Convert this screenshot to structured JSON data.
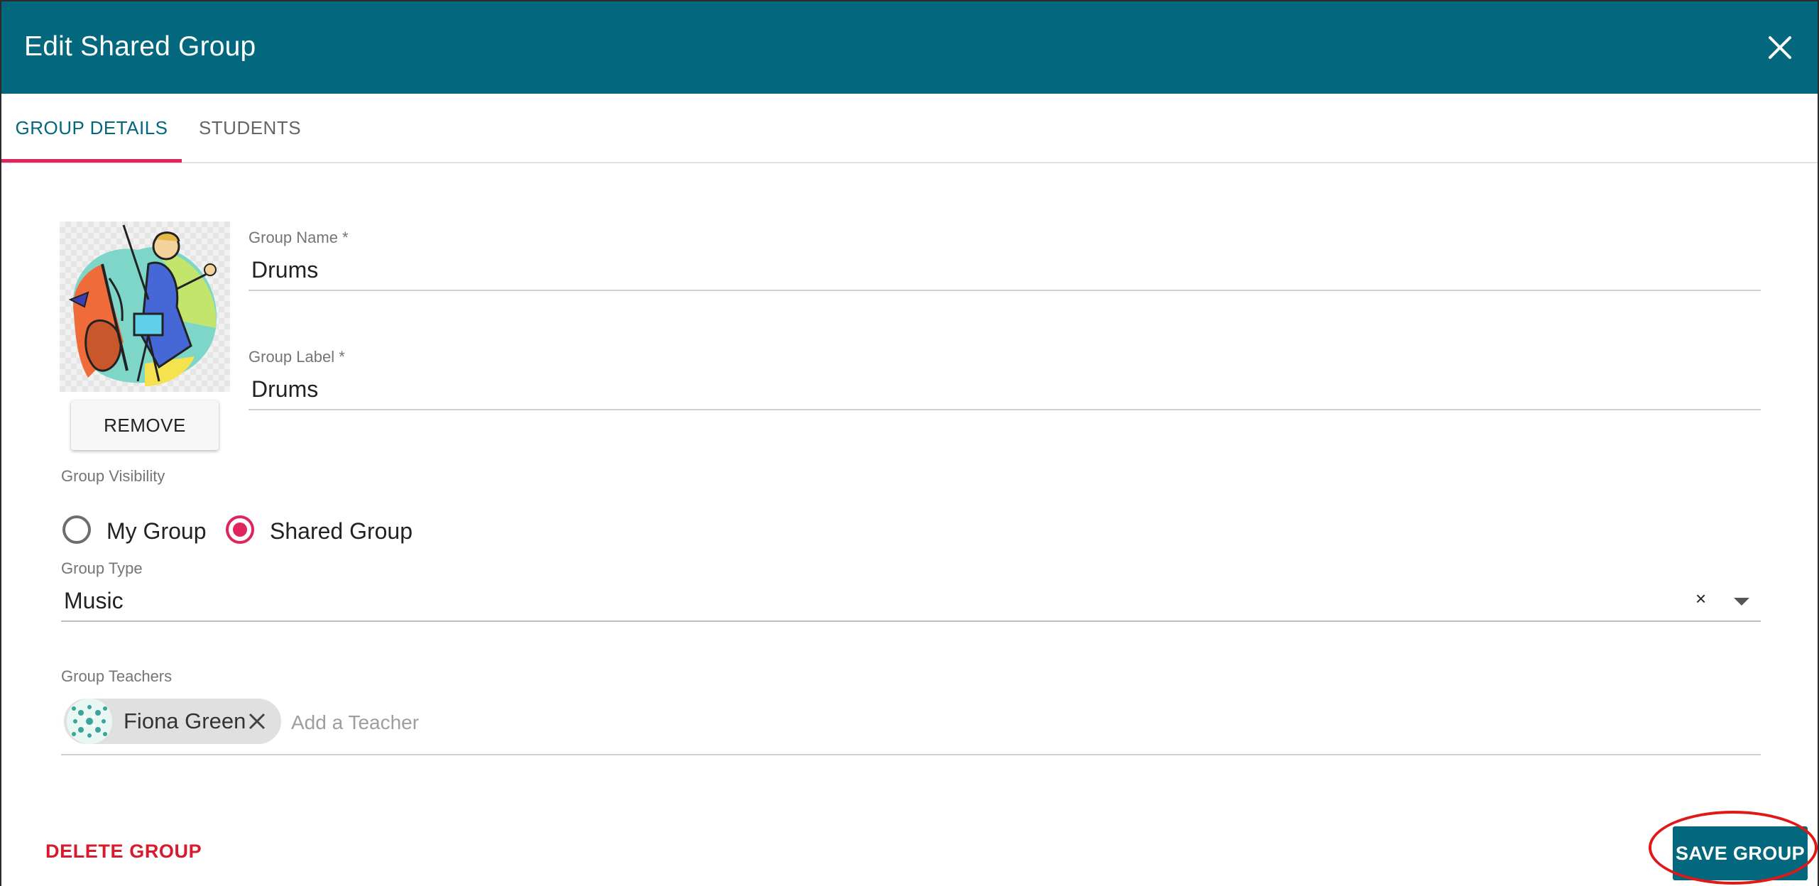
{
  "dialog": {
    "title": "Edit Shared Group",
    "close_icon": "close-icon"
  },
  "tabs": [
    {
      "label": "GROUP DETAILS",
      "active": true
    },
    {
      "label": "STUDENTS",
      "active": false
    }
  ],
  "avatar": {
    "image_icon": "orchestra-conductor-illustration",
    "remove_label": "REMOVE"
  },
  "fields": {
    "group_name": {
      "label": "Group Name *",
      "value": "Drums"
    },
    "group_label": {
      "label": "Group Label *",
      "value": "Drums"
    },
    "visibility": {
      "label": "Group Visibility",
      "options": [
        {
          "label": "My Group",
          "checked": false
        },
        {
          "label": "Shared Group",
          "checked": true
        }
      ]
    },
    "group_type": {
      "label": "Group Type",
      "value": "Music",
      "clear_label": "×"
    },
    "teachers": {
      "label": "Group Teachers",
      "chips": [
        {
          "name": "Fiona Green"
        }
      ],
      "placeholder": "Add a Teacher"
    }
  },
  "actions": {
    "delete_label": "DELETE GROUP",
    "save_label": "SAVE GROUP"
  },
  "colors": {
    "primary": "#03677e",
    "accent": "#e0245e",
    "danger": "#d81b2c",
    "highlight": "#e01818"
  }
}
